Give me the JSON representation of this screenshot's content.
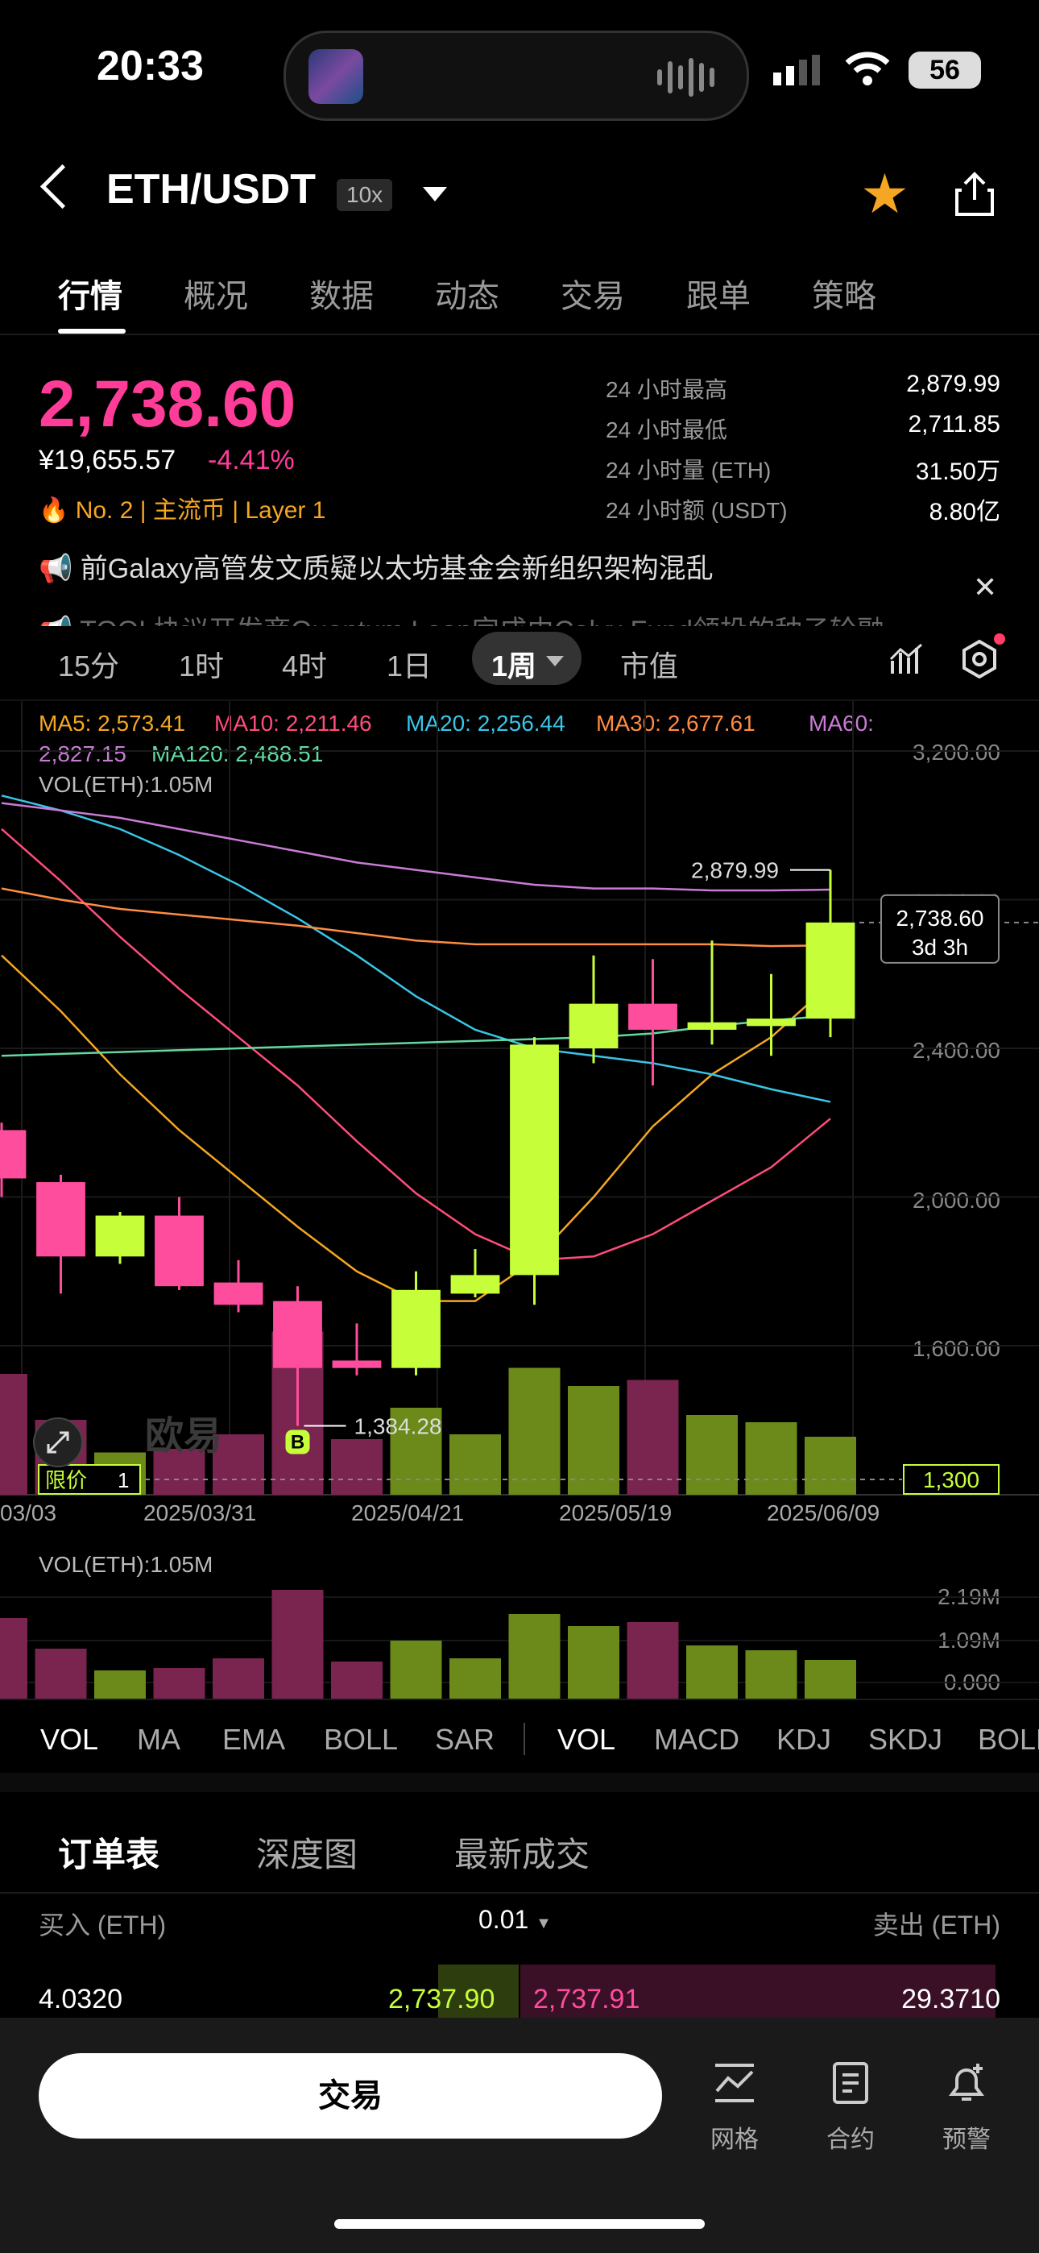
{
  "status": {
    "time": "20:33",
    "battery": "56"
  },
  "header": {
    "pair": "ETH/USDT",
    "leverage": "10x"
  },
  "tabs": [
    "行情",
    "概况",
    "数据",
    "动态",
    "交易",
    "跟单",
    "策略"
  ],
  "ticker": {
    "price": "2,738.60",
    "cny": "¥19,655.57",
    "change": "-4.41%",
    "tags": "No. 2  |  主流币  |  Layer 1",
    "stats": [
      {
        "label": "24 小时最高",
        "value": "2,879.99"
      },
      {
        "label": "24 小时最低",
        "value": "2,711.85"
      },
      {
        "label": "24 小时量 (ETH)",
        "value": "31.50万"
      },
      {
        "label": "24 小时额 (USDT)",
        "value": "8.80亿"
      }
    ]
  },
  "news": {
    "line1": "前Galaxy高管发文质疑以太坊基金会新组织架构混乱",
    "line2": "TOOL协议开发商Quantum Leap完成由Calyx Fund领投的种子轮融"
  },
  "intervals": {
    "items": [
      "15分",
      "1时",
      "4时",
      "1日"
    ],
    "active": "1周",
    "extra": "市值"
  },
  "ma_legend": {
    "ma5": "MA5: 2,573.41",
    "ma10": "MA10: 2,211.46",
    "ma20": "MA20: 2,256.44",
    "ma30": "MA30: 2,677.61",
    "ma60": "MA60:",
    "ma60v": "2,827.15",
    "ma120": "MA120: 2,488.51",
    "vol": "VOL(ETH):1.05M"
  },
  "colors": {
    "up": "#c6ff3a",
    "down": "#ff4d9e",
    "vol_up": "#6b8a1a",
    "vol_down": "#7a2450"
  },
  "chart_data": {
    "type": "candlestick",
    "x_ticks": [
      "03/03",
      "2025/03/31",
      "2025/04/21",
      "2025/05/19",
      "2025/06/09"
    ],
    "y_ticks": [
      "3,200.00",
      "2,800.00",
      "2,400.00",
      "2,000.00",
      "1,600.00"
    ],
    "ylim": [
      1300,
      3200
    ],
    "candles": [
      {
        "open": 2180,
        "close": 2050,
        "high": 2200,
        "low": 2000
      },
      {
        "open": 2040,
        "close": 1840,
        "high": 2060,
        "low": 1740
      },
      {
        "open": 1840,
        "close": 1950,
        "high": 1960,
        "low": 1820
      },
      {
        "open": 1950,
        "close": 1760,
        "high": 2000,
        "low": 1750
      },
      {
        "open": 1770,
        "close": 1710,
        "high": 1830,
        "low": 1690
      },
      {
        "open": 1720,
        "close": 1540,
        "high": 1760,
        "low": 1384.28
      },
      {
        "open": 1560,
        "close": 1540,
        "high": 1660,
        "low": 1520
      },
      {
        "open": 1540,
        "close": 1750,
        "high": 1800,
        "low": 1520
      },
      {
        "open": 1740,
        "close": 1790,
        "high": 1860,
        "low": 1730
      },
      {
        "open": 1790,
        "close": 2410,
        "high": 2430,
        "low": 1710
      },
      {
        "open": 2400,
        "close": 2520,
        "high": 2650,
        "low": 2360
      },
      {
        "open": 2520,
        "close": 2450,
        "high": 2640,
        "low": 2300
      },
      {
        "open": 2450,
        "close": 2470,
        "high": 2690,
        "low": 2410
      },
      {
        "open": 2460,
        "close": 2480,
        "high": 2600,
        "low": 2380
      },
      {
        "open": 2480,
        "close": 2738.6,
        "high": 2879.99,
        "low": 2430
      }
    ],
    "volumes": [
      1.0,
      0.62,
      0.35,
      0.38,
      0.5,
      1.35,
      0.46,
      0.72,
      0.5,
      1.05,
      0.9,
      0.95,
      0.66,
      0.6,
      0.48
    ],
    "ma_lines": [
      {
        "name": "MA5",
        "color": "#f5a623",
        "values": [
          2650,
          2500,
          2330,
          2180,
          2050,
          1920,
          1800,
          1720,
          1720,
          1830,
          2000,
          2190,
          2330,
          2430,
          2573
        ]
      },
      {
        "name": "MA10",
        "color": "#ff4d7a",
        "values": [
          2990,
          2850,
          2700,
          2560,
          2430,
          2300,
          2150,
          2010,
          1900,
          1830,
          1840,
          1900,
          1990,
          2080,
          2211
        ]
      },
      {
        "name": "MA20",
        "color": "#39c6e6",
        "values": [
          3080,
          3040,
          2990,
          2920,
          2840,
          2750,
          2650,
          2540,
          2450,
          2400,
          2380,
          2360,
          2330,
          2290,
          2256
        ]
      },
      {
        "name": "MA30",
        "color": "#ff8c42",
        "values": [
          2830,
          2800,
          2775,
          2760,
          2745,
          2730,
          2710,
          2690,
          2680,
          2680,
          2680,
          2680,
          2680,
          2675,
          2677
        ]
      },
      {
        "name": "MA60",
        "color": "#c97bd6",
        "values": [
          3060,
          3040,
          3020,
          2990,
          2960,
          2930,
          2900,
          2880,
          2860,
          2840,
          2830,
          2830,
          2825,
          2825,
          2827
        ]
      },
      {
        "name": "MA120",
        "color": "#63d9a0",
        "values": [
          2380,
          2385,
          2390,
          2395,
          2400,
          2405,
          2410,
          2415,
          2420,
          2425,
          2430,
          2440,
          2460,
          2475,
          2488
        ]
      }
    ],
    "annotations": {
      "high": "2,879.99",
      "low": "1,384.28",
      "last": "2,738.60",
      "countdown": "3d 3h",
      "limit_label": "限价",
      "limit_qty": "1",
      "limit_price": "1,300",
      "marker": "B",
      "watermark": "欧易"
    }
  },
  "vol_panel": {
    "label": "VOL(ETH):1.05M",
    "ticks": [
      "2.19M",
      "1.09M",
      "0.000"
    ]
  },
  "indicators": {
    "main": [
      "VOL",
      "MA",
      "EMA",
      "BOLL",
      "SAR"
    ],
    "sub": [
      "VOL",
      "MACD",
      "KDJ",
      "SKDJ",
      "BOLL"
    ]
  },
  "orderbook": {
    "tabs": [
      "订单表",
      "深度图",
      "最新成交"
    ],
    "buy_header": "买入 (ETH)",
    "precision": "0.01",
    "sell_header": "卖出 (ETH)",
    "row": {
      "buy_qty": "4.0320",
      "bid": "2,737.90",
      "ask": "2,737.91",
      "sell_qty": "29.3710"
    }
  },
  "bottom_bar": {
    "trade": "交易",
    "grid": "网格",
    "contract": "合约",
    "alert": "预警"
  }
}
